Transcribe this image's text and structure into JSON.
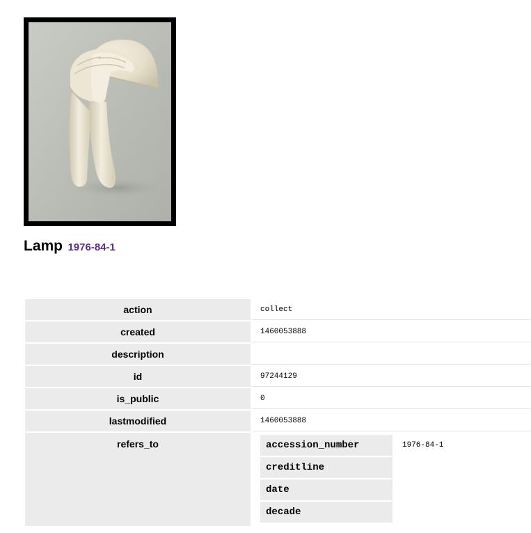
{
  "object": {
    "title": "Lamp",
    "accession_number": "1976-84-1",
    "image_alt": "Lamp"
  },
  "properties": [
    {
      "key": "action",
      "value": "collect"
    },
    {
      "key": "created",
      "value": "1460053888"
    },
    {
      "key": "description",
      "value": ""
    },
    {
      "key": "id",
      "value": "97244129"
    },
    {
      "key": "is_public",
      "value": "0"
    },
    {
      "key": "lastmodified",
      "value": "1460053888"
    }
  ],
  "refers_to": {
    "key": "refers_to",
    "fields": [
      {
        "key": "accession_number",
        "value": "1976-84-1"
      },
      {
        "key": "creditline",
        "value": ""
      },
      {
        "key": "date",
        "value": ""
      },
      {
        "key": "decade",
        "value": ""
      }
    ]
  }
}
